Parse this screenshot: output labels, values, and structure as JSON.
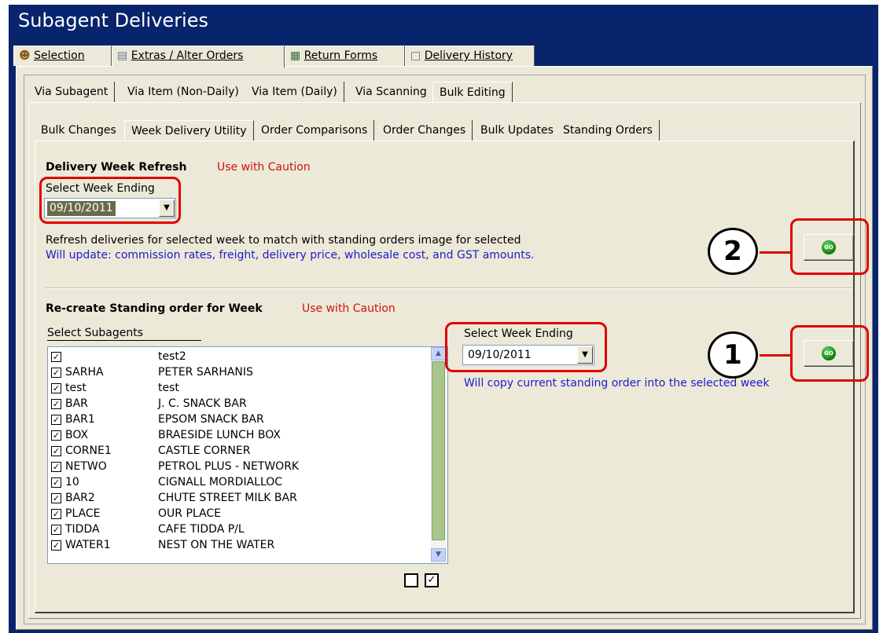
{
  "window": {
    "title": "Subagent Deliveries"
  },
  "main_tabs": [
    {
      "label": "Selection",
      "icon": "people-icon"
    },
    {
      "label": "Extras / Alter Orders",
      "icon": "book-icon"
    },
    {
      "label": "Return Forms",
      "icon": "form-icon"
    },
    {
      "label": "Delivery History",
      "icon": "history-icon"
    }
  ],
  "sub_tabs": [
    "Via Subagent",
    "Via Item (Non-Daily)",
    "Via Item (Daily)",
    "Via Scanning",
    "Bulk Editing"
  ],
  "bulk_tabs": [
    "Bulk Changes",
    "Week Delivery Utility",
    "Order Comparisons",
    "Order Changes",
    "Bulk Updates",
    "Standing Orders"
  ],
  "refresh": {
    "heading": "Delivery Week Refresh",
    "caution": "Use with Caution",
    "select_label": "Select Week Ending",
    "week_value": "09/10/2011",
    "desc1": "Refresh deliveries for selected week to match with standing orders image for selected",
    "desc2": "Will update: commission rates, freight, delivery price, wholesale cost, and GST amounts.",
    "go_label": "GO",
    "callout": "2"
  },
  "recreate": {
    "heading": "Re-create Standing order for Week",
    "caution": "Use with Caution",
    "subagents_label": "Select Subagents",
    "select_label": "Select Week Ending",
    "week_value": "09/10/2011",
    "desc": "Will copy current standing order into the selected week",
    "go_label": "GO",
    "callout": "1"
  },
  "subagents": [
    {
      "checked": true,
      "code": "",
      "name": "test2"
    },
    {
      "checked": true,
      "code": "SARHA",
      "name": "PETER SARHANIS"
    },
    {
      "checked": true,
      "code": "test",
      "name": "test"
    },
    {
      "checked": true,
      "code": "BAR",
      "name": "J. C. SNACK BAR"
    },
    {
      "checked": true,
      "code": "BAR1",
      "name": "EPSOM SNACK BAR"
    },
    {
      "checked": true,
      "code": "BOX",
      "name": "BRAESIDE LUNCH BOX"
    },
    {
      "checked": true,
      "code": "CORNE1",
      "name": "CASTLE CORNER"
    },
    {
      "checked": true,
      "code": "NETWO",
      "name": "PETROL PLUS - NETWORK"
    },
    {
      "checked": true,
      "code": "10",
      "name": "CIGNALL MORDIALLOC"
    },
    {
      "checked": true,
      "code": "BAR2",
      "name": "CHUTE STREET MILK BAR"
    },
    {
      "checked": true,
      "code": "PLACE",
      "name": "OUR PLACE"
    },
    {
      "checked": true,
      "code": "TIDDA",
      "name": "CAFE TIDDA P/L"
    },
    {
      "checked": true,
      "code": "WATER1",
      "name": "NEST ON THE WATER"
    }
  ],
  "check_glyph": "☑",
  "check_mark": "✓",
  "colors": {
    "titlebar": "#08246c",
    "caution": "#d01010",
    "info": "#1c1ccc",
    "highlight": "#e00000"
  }
}
